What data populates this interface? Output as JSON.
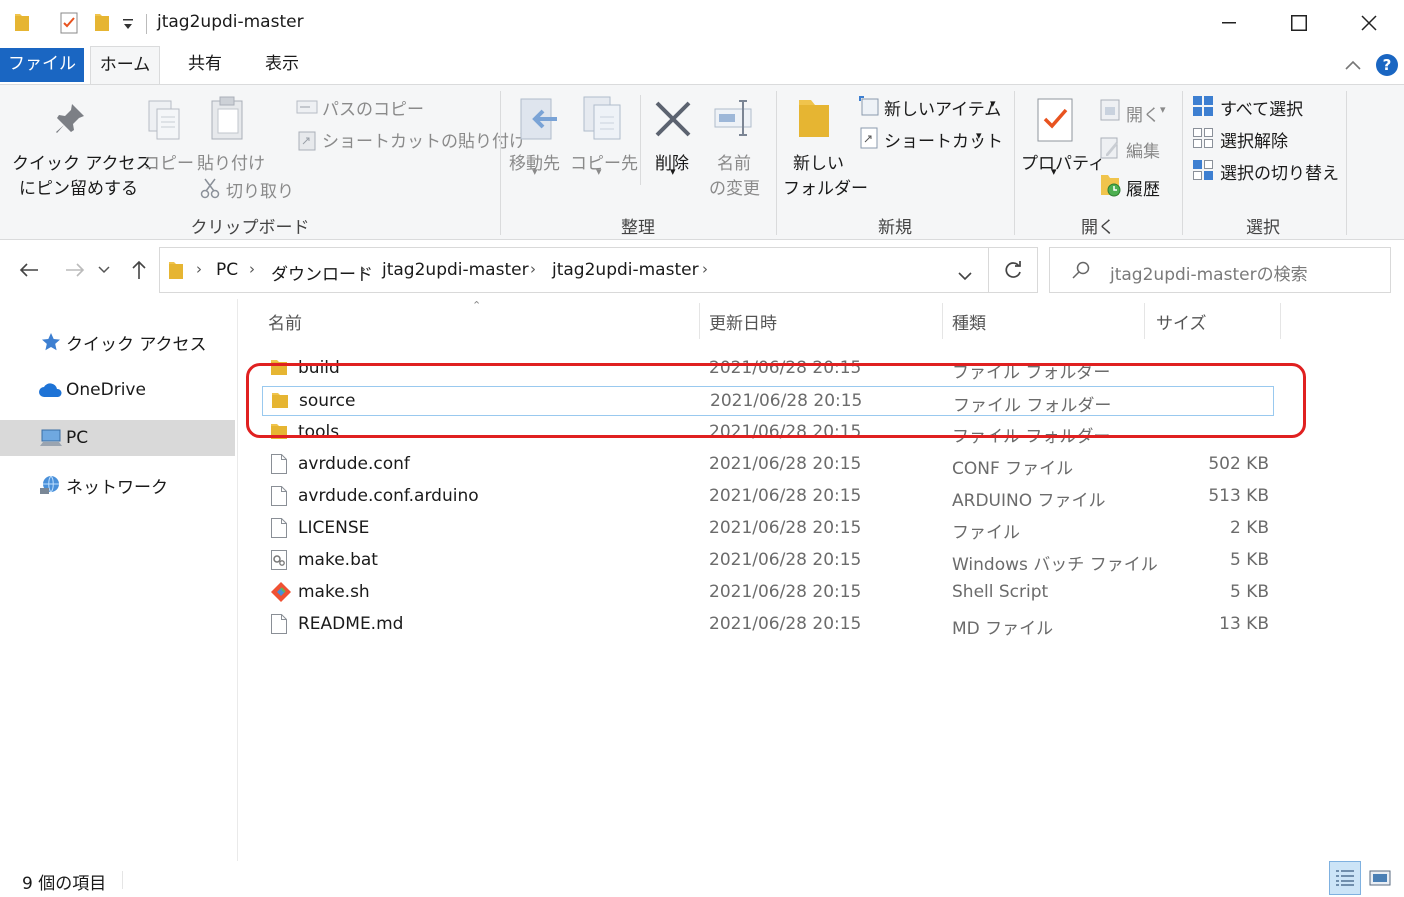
{
  "window": {
    "title": "jtag2updi-master"
  },
  "tabs": {
    "file": "ファイル",
    "home": "ホーム",
    "share": "共有",
    "view": "表示"
  },
  "ribbon": {
    "clipboard": {
      "pin_line1": "クイック アクセス",
      "pin_line2": "にピン留めする",
      "copy": "コピー",
      "paste": "貼り付け",
      "copy_path": "パスのコピー",
      "paste_shortcut": "ショートカットの貼り付け",
      "cut": "切り取り",
      "label": "クリップボード"
    },
    "organize": {
      "move_to": "移動先",
      "copy_to": "コピー先",
      "delete": "削除",
      "rename_line1": "名前",
      "rename_line2": "の変更",
      "label": "整理"
    },
    "new": {
      "new_folder_line1": "新しい",
      "new_folder_line2": "フォルダー",
      "new_item": "新しいアイテム",
      "shortcut": "ショートカット",
      "label": "新規"
    },
    "open": {
      "properties": "プロパティ",
      "open": "開く",
      "edit": "編集",
      "history": "履歴",
      "label": "開く"
    },
    "select": {
      "select_all": "すべて選択",
      "select_none": "選択解除",
      "invert": "選択の切り替え",
      "label": "選択"
    }
  },
  "address": {
    "crumbs": [
      "PC",
      "ダウンロード",
      "jtag2updi-master",
      "jtag2updi-master"
    ],
    "search_placeholder": "jtag2updi-masterの検索"
  },
  "nav": {
    "quick_access": "クイック アクセス",
    "onedrive": "OneDrive",
    "pc": "PC",
    "network": "ネットワーク"
  },
  "columns": {
    "name": "名前",
    "date": "更新日時",
    "type": "種類",
    "size": "サイズ"
  },
  "files": [
    {
      "name": "build",
      "date": "2021/06/28 20:15",
      "type": "ファイル フォルダー",
      "size": "",
      "icon": "folder-icon"
    },
    {
      "name": "source",
      "date": "2021/06/28 20:15",
      "type": "ファイル フォルダー",
      "size": "",
      "icon": "folder-icon"
    },
    {
      "name": "tools",
      "date": "2021/06/28 20:15",
      "type": "ファイル フォルダー",
      "size": "",
      "icon": "folder-icon"
    },
    {
      "name": "avrdude.conf",
      "date": "2021/06/28 20:15",
      "type": "CONF ファイル",
      "size": "502 KB",
      "icon": "file-icon"
    },
    {
      "name": "avrdude.conf.arduino",
      "date": "2021/06/28 20:15",
      "type": "ARDUINO ファイル",
      "size": "513 KB",
      "icon": "file-icon"
    },
    {
      "name": "LICENSE",
      "date": "2021/06/28 20:15",
      "type": "ファイル",
      "size": "2 KB",
      "icon": "file-icon"
    },
    {
      "name": "make.bat",
      "date": "2021/06/28 20:15",
      "type": "Windows バッチ ファイル",
      "size": "5 KB",
      "icon": "batch-file-icon"
    },
    {
      "name": "make.sh",
      "date": "2021/06/28 20:15",
      "type": "Shell Script",
      "size": "5 KB",
      "icon": "git-shell-icon"
    },
    {
      "name": "README.md",
      "date": "2021/06/28 20:15",
      "type": "MD ファイル",
      "size": "13 KB",
      "icon": "file-icon"
    }
  ],
  "status": {
    "item_count": "9 個の項目"
  },
  "colors": {
    "accent": "#1a66c2",
    "selection_border": "#99c9ef",
    "annotation": "#e02020",
    "folder": "#f0c44c"
  }
}
